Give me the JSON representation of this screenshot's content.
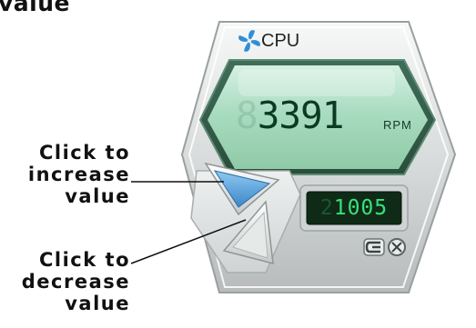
{
  "caption": {
    "title_fragment": "value",
    "increase_lines": [
      "Click to",
      "increase",
      "value"
    ],
    "decrease_lines": [
      "Click to",
      "decrease",
      "value"
    ]
  },
  "monitor": {
    "fan_label": "CPU",
    "rpm_value": "3391",
    "rpm_ghost_digit": "8",
    "rpm_unit": "RPM",
    "threshold_value": "1005",
    "threshold_ghost_digit": "2"
  },
  "icons": {
    "fan": "fan-icon",
    "increase": "triangle-up-button",
    "decrease": "triangle-down-button",
    "settings": "monitor-toggle-icon",
    "close": "close-icon"
  },
  "colors": {
    "lcd_text": "#0b3b22",
    "lcd_bg": "#a9dcc0",
    "threshold_text": "#39e07a",
    "increase_arrow": "#5aa8e0",
    "fan_icon": "#2f8ed6"
  }
}
